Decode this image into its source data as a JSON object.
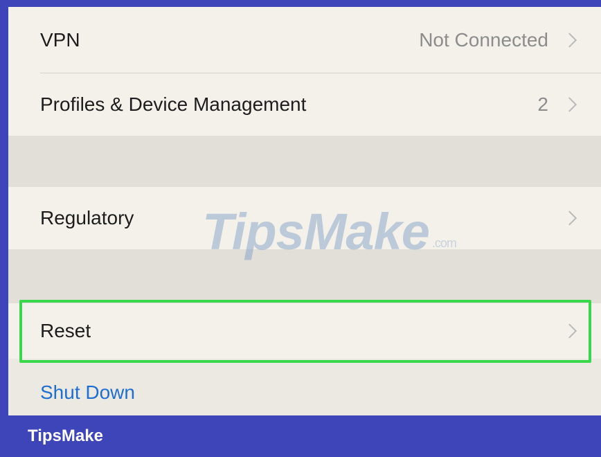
{
  "settings": {
    "rows": [
      {
        "label": "VPN",
        "value": "Not Connected"
      },
      {
        "label": "Profiles & Device Management",
        "value": "2"
      },
      {
        "label": "Regulatory",
        "value": ""
      },
      {
        "label": "Reset",
        "value": ""
      }
    ],
    "shutdown_label": "Shut Down"
  },
  "overlay": {
    "watermark_text": "TipsMake",
    "watermark_suffix": ".com",
    "footer_brand": "TipsMake"
  },
  "colors": {
    "frame_blue": "#3d45b8",
    "highlight_green": "#39d84c",
    "link_blue": "#1f6fd1",
    "secondary_gray": "#8c8c8c"
  },
  "icons": {
    "row_disclosure": "chevron-right-icon"
  }
}
